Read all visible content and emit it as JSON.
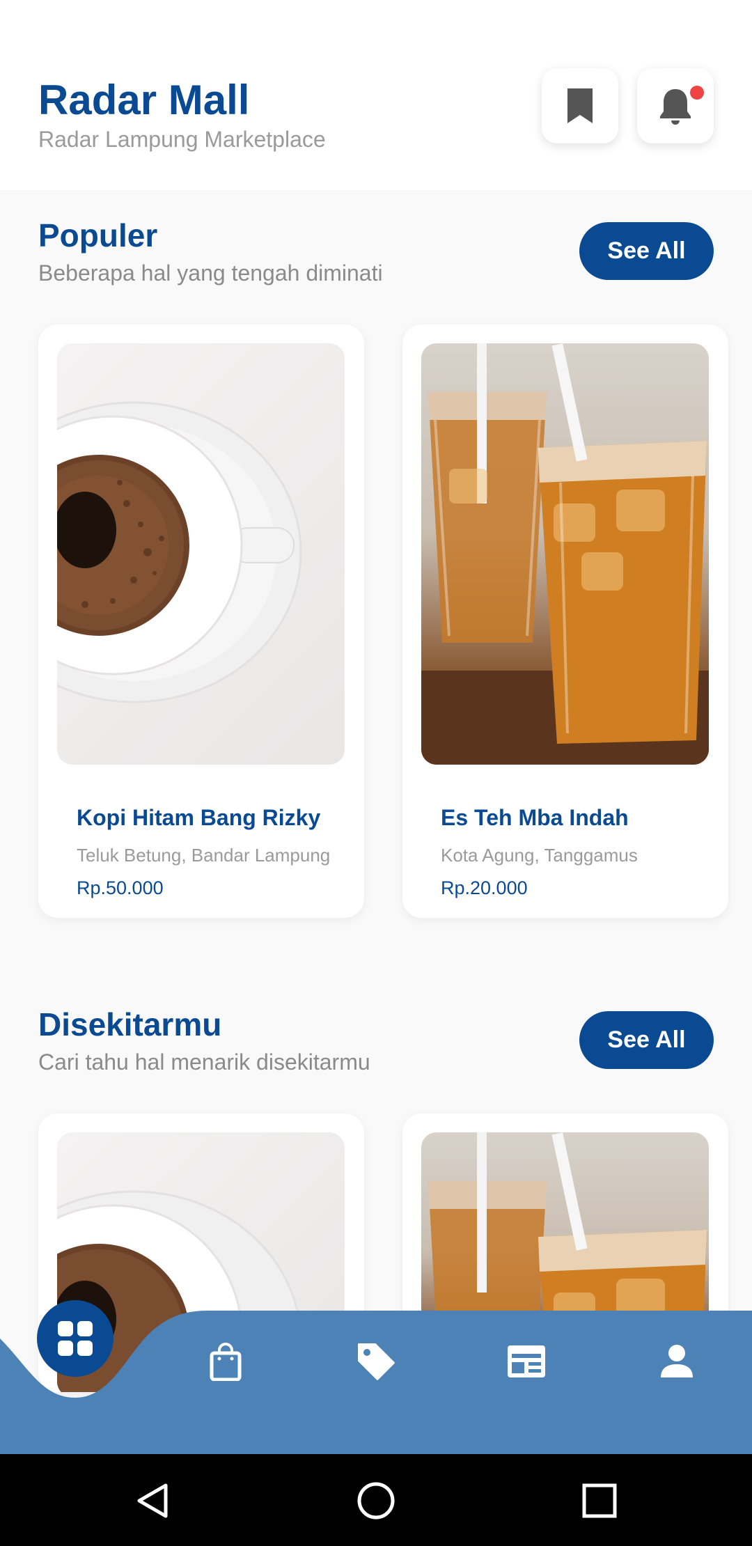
{
  "header": {
    "title": "Radar Mall",
    "subtitle": "Radar Lampung Marketplace",
    "bookmark_icon": "bookmark-icon",
    "bell_icon": "bell-icon"
  },
  "sections": [
    {
      "title": "Populer",
      "subtitle": "Beberapa hal yang tengah diminati",
      "see_all": "See All",
      "items": [
        {
          "name": "Kopi Hitam Bang Rizky",
          "location": "Teluk Betung, Bandar Lampung",
          "price": "Rp.50.000",
          "image": "coffee"
        },
        {
          "name": "Es Teh Mba Indah",
          "location": "Kota Agung, Tanggamus",
          "price": "Rp.20.000",
          "image": "iced-tea"
        }
      ]
    },
    {
      "title": "Disekitarmu",
      "subtitle": "Cari tahu hal menarik disekitarmu",
      "see_all": "See All",
      "items": [
        {
          "image": "coffee"
        },
        {
          "image": "iced-tea"
        }
      ]
    }
  ],
  "bottom_nav": {
    "items": [
      "home-grid-icon",
      "shopping-bag-icon",
      "tag-icon",
      "newspaper-icon",
      "user-icon"
    ],
    "active": "home-grid-icon"
  },
  "colors": {
    "primary": "#0a4a93",
    "nav_bar": "#4d82b6",
    "notification": "#ef4444"
  }
}
